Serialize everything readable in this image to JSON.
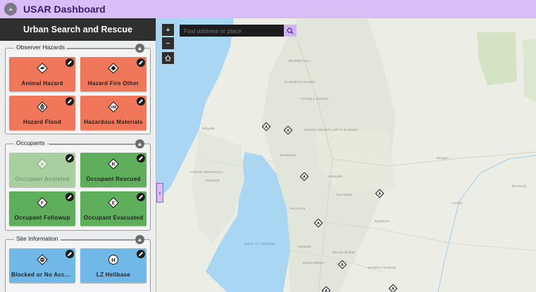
{
  "app": {
    "title": "USAR Dashboard",
    "logo_icon": "app-logo-icon"
  },
  "sidebar": {
    "title": "Urban Search and Rescue"
  },
  "groups": [
    {
      "label": "Observer Hazards",
      "toggle_icon": "chevron-up-icon",
      "tiles": [
        {
          "label": "Animal Hazard",
          "icon": "animal-hazard-icon",
          "color": "#f0775a",
          "state": "active"
        },
        {
          "label": "Hazard Fire Other",
          "icon": "fire-hazard-icon",
          "color": "#f0775a",
          "state": "active"
        },
        {
          "label": "Hazard Flood",
          "icon": "flood-hazard-icon",
          "color": "#f0775a",
          "state": "active"
        },
        {
          "label": "Hazardous Materials",
          "icon": "hazmat-icon",
          "color": "#f0775a",
          "state": "active"
        }
      ]
    },
    {
      "label": "Occupants",
      "toggle_icon": "chevron-up-icon",
      "tiles": [
        {
          "label": "Occupant Assisted",
          "icon": "letter-a-icon",
          "color": "#a8cfa0",
          "state": "disabled"
        },
        {
          "label": "Occupant Rescued",
          "icon": "letter-r-icon",
          "color": "#5fae5c",
          "state": "active"
        },
        {
          "label": "Occupant Followup",
          "icon": "letter-f-icon",
          "color": "#5fae5c",
          "state": "active"
        },
        {
          "label": "Occupant Evacuated",
          "icon": "letter-e-icon",
          "color": "#5fae5c",
          "state": "active"
        }
      ]
    },
    {
      "label": "Site Information",
      "toggle_icon": "chevron-up-icon",
      "tiles": [
        {
          "label": "Blocked or No Access",
          "icon": "no-entry-icon",
          "color": "#6fb8e8",
          "state": "active"
        },
        {
          "label": "LZ Helibase",
          "icon": "helibase-icon",
          "color": "#6fb8e8",
          "state": "active"
        }
      ]
    }
  ],
  "map": {
    "search": {
      "placeholder": "Find address or place"
    },
    "controls": {
      "zoom_in": "+",
      "zoom_out": "−"
    },
    "places": [
      "BROWN HILL",
      "FLINDERS RANGE",
      "TOTHILL RANGE",
      "NORTH MOUNT LOFTY RANGES",
      "Whyalla",
      "Balaklava",
      "Kapunda",
      "YORKE PENINSULA",
      "Maitland",
      "Adelaide",
      "Mount Barker",
      "MURRAY",
      "MURRAY RANGE",
      "Nuriootpa",
      "Murray Bridge",
      "GULF ST VINCENT",
      "Loxton",
      "Renmark",
      "Morgan",
      "Port Pirie"
    ],
    "marker_letter": "A"
  }
}
